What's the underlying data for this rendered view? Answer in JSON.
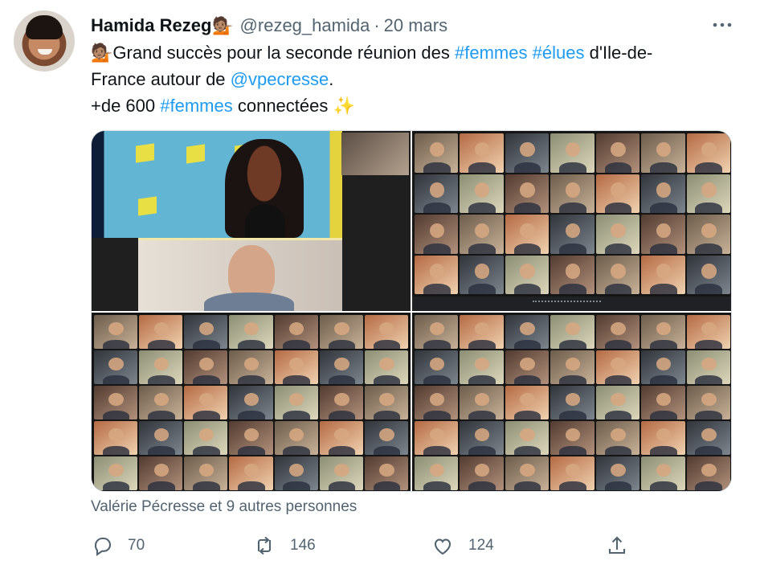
{
  "tweet": {
    "author": {
      "display_name": "Hamida Rezeg",
      "display_name_emoji": "💁🏽",
      "handle": "@rezeg_hamida",
      "separator": "·",
      "date": "20 mars"
    },
    "text_lines": [
      {
        "emoji": "💁🏽",
        "parts": [
          "Grand succès pour la seconde réunion des ",
          "#femmes",
          " ",
          "#élues",
          " d'Ile-de-"
        ]
      },
      {
        "parts": [
          "France autour de ",
          "@vpecresse",
          "."
        ]
      },
      {
        "parts": [
          "+de 600 ",
          "#femmes",
          " connectées ",
          "✨"
        ]
      }
    ],
    "likes_summary": "Valérie Pécresse et 9 autres personnes",
    "actions": {
      "reply_count": "70",
      "retweet_count": "146",
      "like_count": "124"
    },
    "menu_icon": "more-icon"
  },
  "colors": {
    "text": "#0f1419",
    "secondary": "#536471",
    "link": "#1d9bf0",
    "background": "#ffffff"
  }
}
